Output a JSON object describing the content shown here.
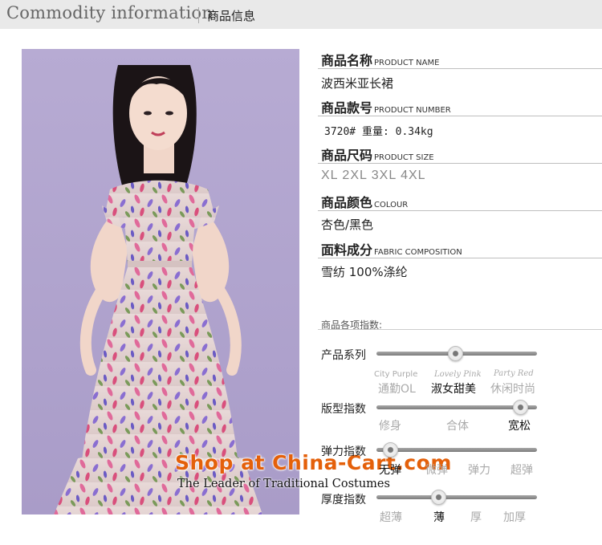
{
  "header": {
    "title_en": "Commodity information",
    "title_cn": "商品信息"
  },
  "watermark": {
    "main": "Shop at China-Cart.com",
    "sub": "The Leader of  Traditional Costumes"
  },
  "product": {
    "name": {
      "label_cn": "商品名称",
      "label_en": "PRODUCT NAME",
      "value": "波西米亚长裙"
    },
    "number": {
      "label_cn": "商品款号",
      "label_en": "PRODUCT NUMBER",
      "value": "3720#  重量: 0.34kg"
    },
    "size": {
      "label_cn": "商品尺码",
      "label_en": "PRODUCT SIZE",
      "value": "XL  2XL  3XL  4XL"
    },
    "colour": {
      "label_cn": "商品颜色",
      "label_en": "COLOUR",
      "value": "杏色/黑色"
    },
    "fabric": {
      "label_cn": "面料成分",
      "label_en": "FABRIC COMPOSITION",
      "value": "雪纺 100%涤纶"
    }
  },
  "indices": {
    "title": "商品各项指数:",
    "series": {
      "label": "产品系列",
      "selected_index": 1,
      "options_en": [
        "City Purple",
        "Lovely Pink",
        "Party Red"
      ],
      "options_cn": [
        "通勤OL",
        "淑女甜美",
        "休闲时尚"
      ]
    },
    "fit": {
      "label": "版型指数",
      "selected_index": 2,
      "options": [
        "修身",
        "合体",
        "宽松"
      ]
    },
    "elasticity": {
      "label": "弹力指数",
      "selected_index": 0,
      "options": [
        "无弹",
        "微弹",
        "弹力",
        "超弹"
      ]
    },
    "thickness": {
      "label": "厚度指数",
      "selected_index": 1,
      "options": [
        "超薄",
        "薄",
        "厚",
        "加厚"
      ]
    }
  },
  "colors": {
    "background_photo": "#b3a6cf",
    "dress": "#e3d3d2",
    "watermark_orange": "#e4600a"
  }
}
